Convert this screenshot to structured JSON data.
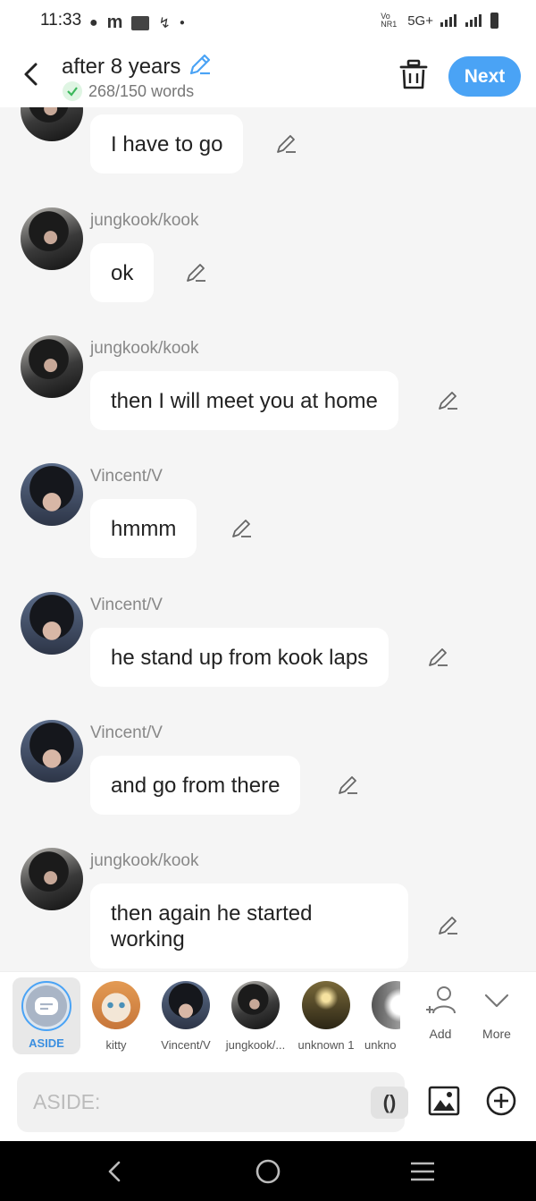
{
  "status": {
    "time": "11:33",
    "left_icons": [
      "chat-bubble",
      "m",
      "paytm",
      "flash",
      "dot"
    ],
    "network_label": "Vo NR1",
    "network_type": "5G+"
  },
  "header": {
    "title": "after 8 years",
    "word_count": "268/150 words",
    "next_label": "Next"
  },
  "messages": [
    {
      "sender": "",
      "avatar": "jk",
      "text": "I have to go"
    },
    {
      "sender": "jungkook/kook",
      "avatar": "jk",
      "text": "ok"
    },
    {
      "sender": "jungkook/kook",
      "avatar": "jk",
      "text": "then I will meet you at home"
    },
    {
      "sender": "Vincent/V",
      "avatar": "v",
      "text": "hmmm"
    },
    {
      "sender": "Vincent/V",
      "avatar": "v",
      "text": "he stand up from kook laps"
    },
    {
      "sender": "Vincent/V",
      "avatar": "v",
      "text": "and go from there"
    },
    {
      "sender": "jungkook/kook",
      "avatar": "jk",
      "text": "then again he started working"
    }
  ],
  "characters": {
    "aside_label": "ASIDE",
    "items": [
      {
        "label": "kitty"
      },
      {
        "label": "Vincent/V"
      },
      {
        "label": "jungkook/..."
      },
      {
        "label": "unknown 1"
      },
      {
        "label": "unkno"
      }
    ],
    "add_label": "Add",
    "more_label": "More"
  },
  "input": {
    "placeholder": "ASIDE:",
    "paren_label": "()"
  },
  "colors": {
    "accent": "#4aa3f5",
    "background": "#f5f5f5",
    "bubble": "#ffffff"
  }
}
